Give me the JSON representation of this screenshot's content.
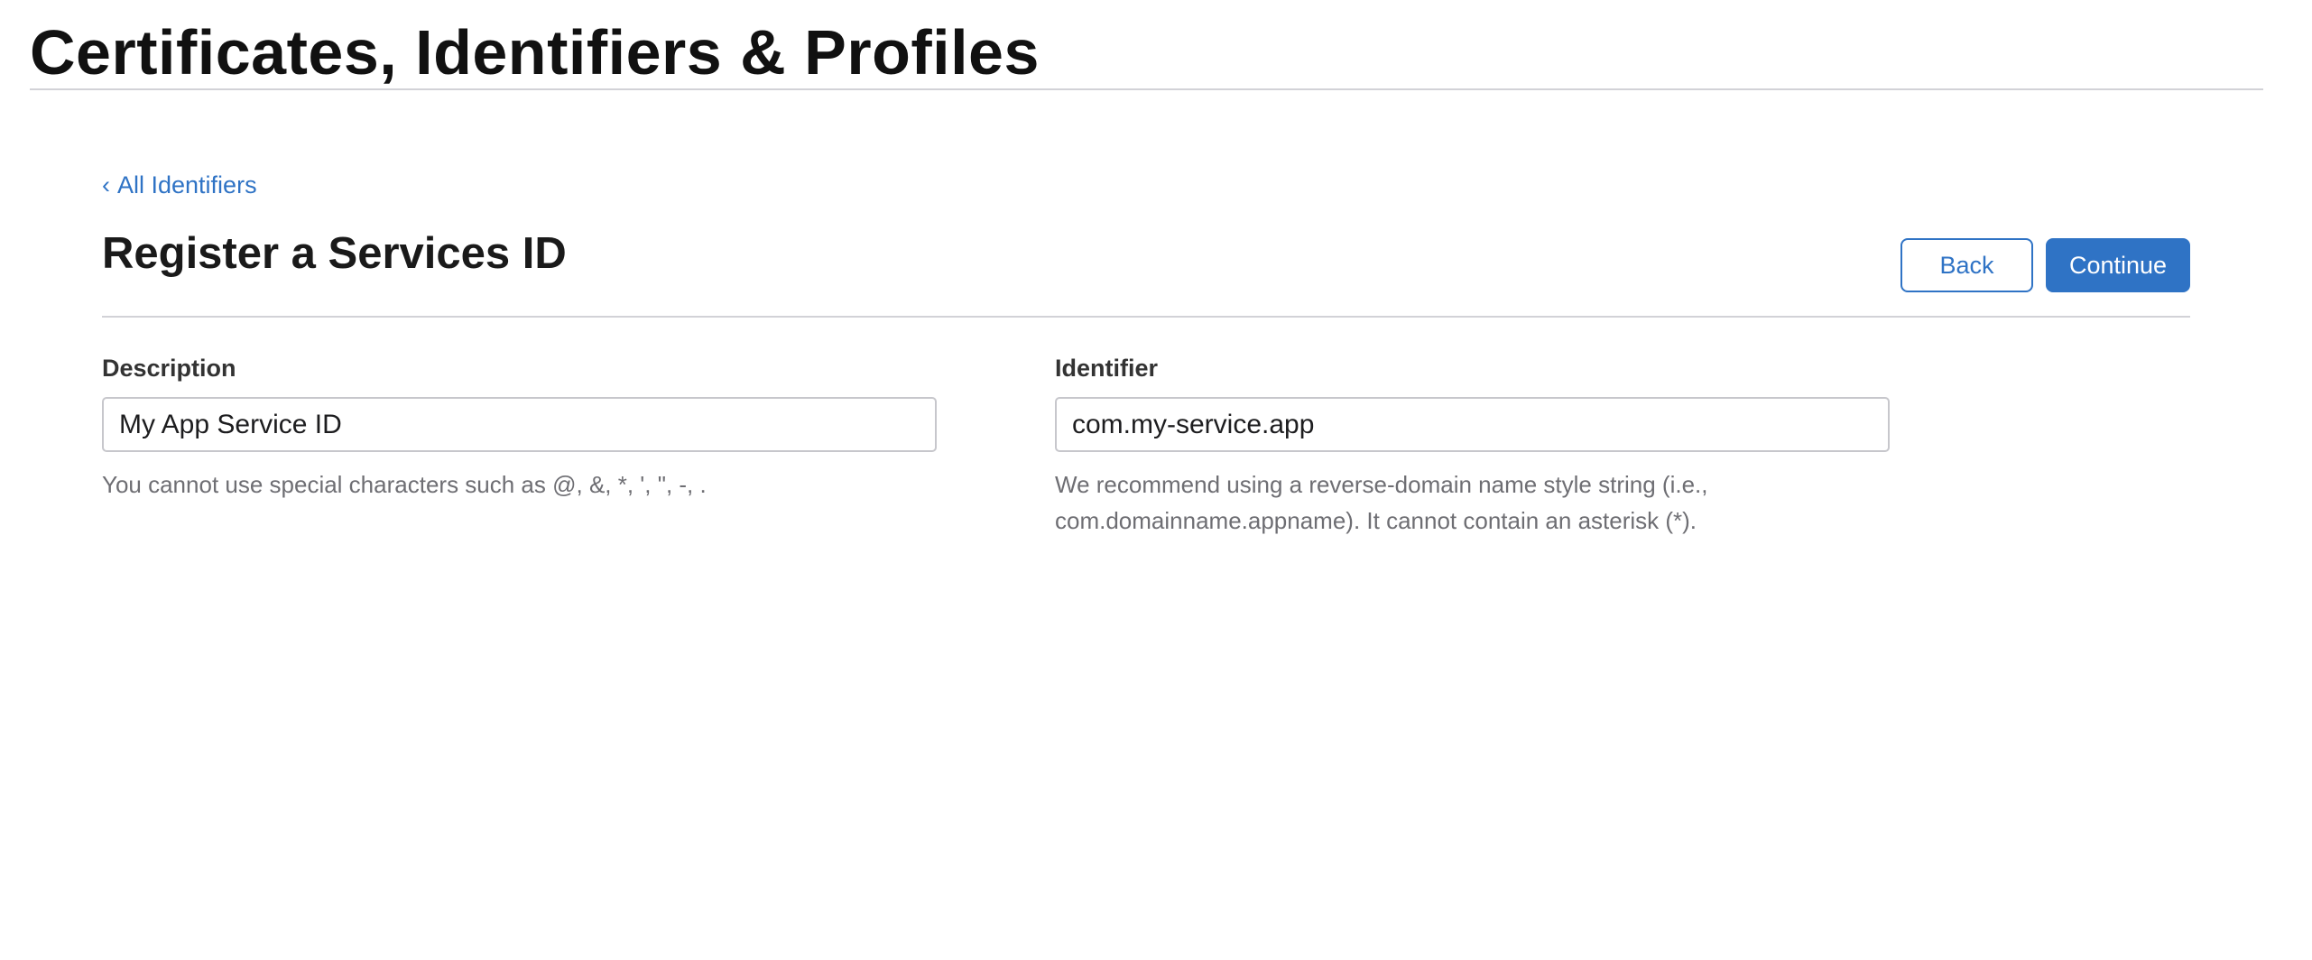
{
  "header": {
    "title": "Certificates, Identifiers & Profiles"
  },
  "nav": {
    "back_link_chevron": "‹",
    "back_link_label": "All Identifiers"
  },
  "section": {
    "title": "Register a Services ID",
    "back_button_label": "Back",
    "continue_button_label": "Continue"
  },
  "form": {
    "description": {
      "label": "Description",
      "value": "My App Service ID",
      "hint": "You cannot use special characters such as @, &, *, ', \", -, ."
    },
    "identifier": {
      "label": "Identifier",
      "value": "com.my-service.app",
      "hint": "We recommend using a reverse-domain name style string (i.e., com.domainname.appname). It cannot contain an asterisk (*)."
    }
  },
  "colors": {
    "accent": "#2f73c5",
    "divider": "#d2d2d7",
    "hint_text": "#6e6e73"
  }
}
